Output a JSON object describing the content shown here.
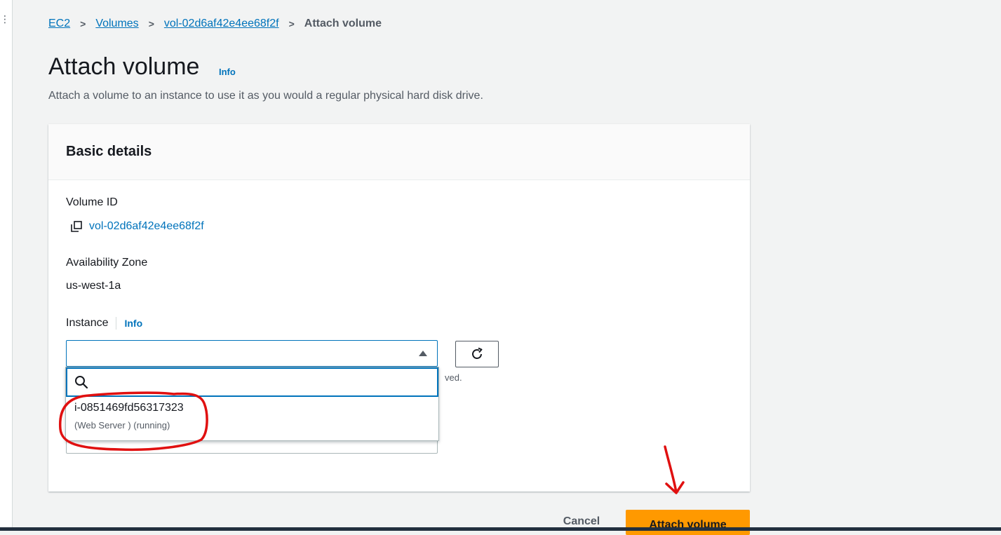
{
  "breadcrumb": {
    "items": [
      "EC2",
      "Volumes",
      "vol-02d6af42e4ee68f2f"
    ],
    "current": "Attach volume"
  },
  "page": {
    "title": "Attach volume",
    "title_info": "Info",
    "description": "Attach a volume to an instance to use it as you would a regular physical hard disk drive."
  },
  "basic_details": {
    "heading": "Basic details",
    "volume_id_label": "Volume ID",
    "volume_id": "vol-02d6af42e4ee68f2f",
    "az_label": "Availability Zone",
    "az_value": "us-west-1a",
    "instance_label": "Instance",
    "instance_info": "Info",
    "instance_value": "",
    "help_partial": "ved."
  },
  "dropdown": {
    "search_placeholder": "",
    "options": [
      {
        "id": "i-0851469fd56317323",
        "desc": "(Web Server ) (running)"
      }
    ]
  },
  "actions": {
    "cancel": "Cancel",
    "attach": "Attach volume"
  },
  "colors": {
    "link": "#0073bb",
    "primary_button": "#ff9900",
    "annotation": "#e01010"
  },
  "icons": [
    "kebab-icon",
    "chevron-right-icon",
    "copy-icon",
    "caret-up-icon",
    "refresh-icon",
    "search-icon"
  ]
}
